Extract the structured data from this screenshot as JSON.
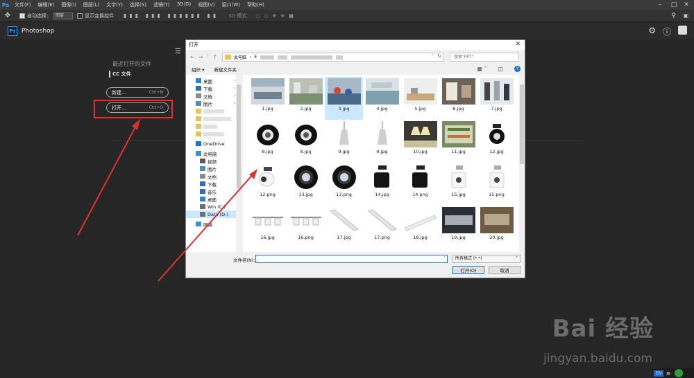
{
  "app": {
    "logo": "Ps",
    "title": "Photoshop",
    "menu": [
      "文件(F)",
      "编辑(E)",
      "图像(I)",
      "图层(L)",
      "文字(Y)",
      "选择(S)",
      "滤镜(T)",
      "3D(D)",
      "视图(V)",
      "窗口(W)",
      "帮助(H)"
    ]
  },
  "options_bar": {
    "auto_select_label": "自动选择：",
    "auto_select_value": "图层",
    "show_transform_label": "显示变换控件",
    "mode_3d_label": "3D 模式："
  },
  "start_screen": {
    "recent_title": "最近打开的文件",
    "cc_files": "CC 文件",
    "new_label": "新建...",
    "new_shortcut": "Ctrl+N",
    "open_label": "打开...",
    "open_shortcut": "Ctrl+O"
  },
  "dialog": {
    "title": "打开",
    "address_root": "此电脑",
    "address_first": "E",
    "search_placeholder": "搜索\"PPT\"",
    "organize": "组织 ▾",
    "new_folder": "新建文件夹",
    "nav_items": [
      {
        "label": "桌面",
        "icon": "desktop-icon",
        "color": "#2f86d6",
        "pinned": true
      },
      {
        "label": "下载",
        "icon": "download-icon",
        "color": "#2f6fbd",
        "pinned": true
      },
      {
        "label": "文档",
        "icon": "document-icon",
        "color": "#8a8a8a",
        "pinned": true
      },
      {
        "label": "图片",
        "icon": "pictures-icon",
        "color": "#4a90c2",
        "pinned": true
      },
      {
        "label": "",
        "icon": "folder-icon",
        "color": "#e8c15a",
        "pinned": false
      },
      {
        "label": "",
        "icon": "folder-icon",
        "color": "#e8c15a",
        "pinned": false
      },
      {
        "label": "",
        "icon": "folder-icon",
        "color": "#e8c15a",
        "pinned": false
      },
      {
        "label": "",
        "icon": "folder-icon",
        "color": "#e8c15a",
        "pinned": false
      },
      {
        "label": "OneDrive",
        "icon": "cloud-icon",
        "color": "#1e73d2",
        "pinned": false
      },
      {
        "label": "此电脑",
        "icon": "computer-icon",
        "color": "#3c8fd9",
        "pinned": false
      },
      {
        "label": "视频",
        "icon": "video-icon",
        "color": "#5a5a5a",
        "pinned": false
      },
      {
        "label": "图片",
        "icon": "pictures-icon",
        "color": "#4a90c2",
        "pinned": false
      },
      {
        "label": "文档",
        "icon": "document-icon",
        "color": "#8a8a8a",
        "pinned": false
      },
      {
        "label": "下载",
        "icon": "download-icon",
        "color": "#2f6fbd",
        "pinned": false
      },
      {
        "label": "音乐",
        "icon": "music-icon",
        "color": "#2f6fbd",
        "pinned": false
      },
      {
        "label": "桌面",
        "icon": "desktop-icon",
        "color": "#2f86d6",
        "pinned": false
      },
      {
        "label": "Win (C:)",
        "icon": "drive-icon",
        "color": "#6f6f6f",
        "pinned": false
      },
      {
        "label": "Data (D:)",
        "icon": "drive-icon",
        "color": "#6f6f6f",
        "pinned": false,
        "selected": true
      },
      {
        "label": "网络",
        "icon": "network-icon",
        "color": "#3c8fd9",
        "pinned": false
      }
    ],
    "files": [
      {
        "name": "1.jpg",
        "kind": "office"
      },
      {
        "name": "2.jpg",
        "kind": "factory"
      },
      {
        "name": "3.jpg",
        "kind": "people",
        "selected": true
      },
      {
        "name": "4.jpg",
        "kind": "office2"
      },
      {
        "name": "5.jpg",
        "kind": "room"
      },
      {
        "name": "6.jpg",
        "kind": "interior"
      },
      {
        "name": "7.jpg",
        "kind": "panels"
      },
      {
        "name": "8.jpg",
        "kind": "spot-dark"
      },
      {
        "name": "8.jpg",
        "kind": "spot-dark"
      },
      {
        "name": "9.jpg",
        "kind": "pendant"
      },
      {
        "name": "9.jpg",
        "kind": "pendant"
      },
      {
        "name": "10.jpg",
        "kind": "pendants"
      },
      {
        "name": "11.jpg",
        "kind": "shop"
      },
      {
        "name": "12.jpg",
        "kind": "track-dark"
      },
      {
        "name": "12.png",
        "kind": "track-white"
      },
      {
        "name": "13.jpg",
        "kind": "ring"
      },
      {
        "name": "13.png",
        "kind": "ring"
      },
      {
        "name": "14.jpg",
        "kind": "cylinder"
      },
      {
        "name": "14.png",
        "kind": "cylinder"
      },
      {
        "name": "15.jpg",
        "kind": "track-white2"
      },
      {
        "name": "15.png",
        "kind": "track-white2"
      },
      {
        "name": "16.jpg",
        "kind": "multi"
      },
      {
        "name": "16.png",
        "kind": "multi"
      },
      {
        "name": "17.jpg",
        "kind": "linear"
      },
      {
        "name": "17.png",
        "kind": "linear"
      },
      {
        "name": "18.jpg",
        "kind": "bar"
      },
      {
        "name": "19.jpg",
        "kind": "blur-dark"
      },
      {
        "name": "20.jpg",
        "kind": "blur-brown"
      }
    ],
    "filename_label": "文件名(N):",
    "filename_value": "",
    "filetype_value": "所有格式 (*.*)",
    "open_button": "打开(O)",
    "cancel_button": "取消"
  },
  "watermark": {
    "brand": "Bai 经验",
    "url": "jingyan.baidu.com"
  },
  "tray": {
    "lang": "EN"
  }
}
